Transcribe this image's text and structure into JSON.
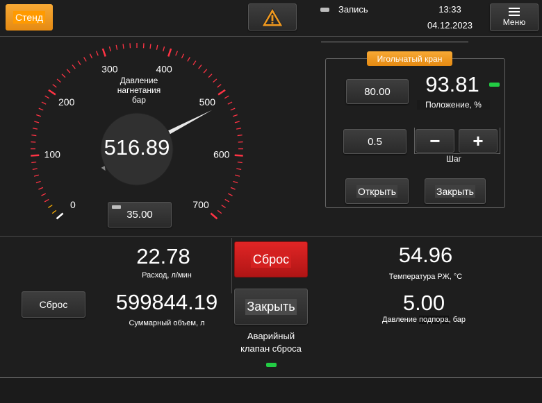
{
  "header": {
    "stand_label": "Стенд",
    "warning_icon": "warning-triangle-icon",
    "record_label": "Запись",
    "time": "13:33",
    "date": "04.12.2023",
    "menu_label": "Меню",
    "menu_icon": "hamburger-icon"
  },
  "gauge": {
    "title_line1": "Давление",
    "title_line2": "нагнетания",
    "unit": "бар",
    "value": "516.89",
    "setpoint": "35.00",
    "min": 0,
    "max": 700,
    "current": 516.89,
    "tick_labels": [
      "0",
      "100",
      "200",
      "300",
      "400",
      "500",
      "600",
      "700"
    ]
  },
  "needle_valve": {
    "title": "Игольчатый кран",
    "setpoint": "80.00",
    "position_value": "93.81",
    "position_label": "Положение, %",
    "step_value": "0.5",
    "minus_label": "−",
    "plus_label": "+",
    "step_label": "Шаг",
    "open_label": "Открыть",
    "close_label": "Закрыть"
  },
  "flow": {
    "reset_label": "Сброс",
    "flow_value": "22.78",
    "flow_label": "Расход, л/мин",
    "volume_value": "599844.19",
    "volume_label": "Суммарный объем, л"
  },
  "emergency": {
    "reset_label": "Сброс",
    "close_label": "Закрыть",
    "label_line1": "Аварийный",
    "label_line2": "клапан сброса"
  },
  "readouts": {
    "temp_value": "54.96",
    "temp_label": "Температура РЖ, °C",
    "backpressure_value": "5.00",
    "backpressure_label_a": "Давление ",
    "backpressure_label_b": "подпора",
    "backpressure_label_c": ", бар"
  },
  "colors": {
    "accent_orange": "#f39a1e",
    "danger_red": "#d42020",
    "led_green": "#22cc44",
    "tick_red": "#ff3344"
  }
}
